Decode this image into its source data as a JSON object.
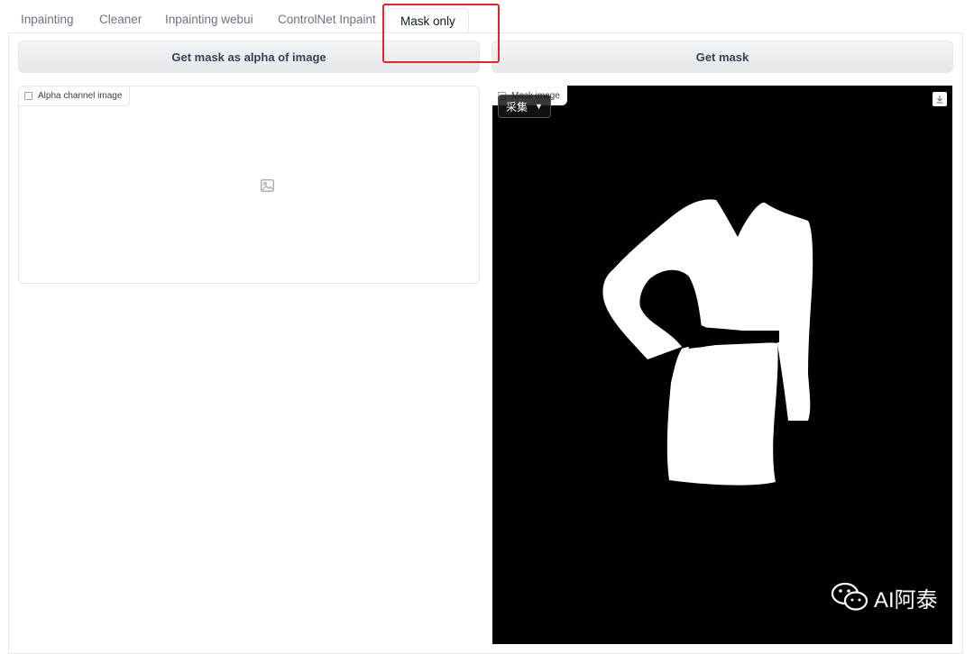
{
  "tabs": [
    {
      "label": "Inpainting"
    },
    {
      "label": "Cleaner"
    },
    {
      "label": "Inpainting webui"
    },
    {
      "label": "ControlNet Inpaint"
    },
    {
      "label": "Mask only",
      "active": true
    }
  ],
  "buttons": {
    "alpha": "Get mask as alpha of image",
    "mask": "Get mask"
  },
  "alpha_panel": {
    "label": "Alpha channel image",
    "icon": "image-placeholder-icon"
  },
  "mask_panel": {
    "label": "Mask image",
    "overlay_chip": "采集",
    "watermark": "AI阿泰",
    "icon": "download-icon"
  },
  "colors": {
    "highlight": "#e0262d",
    "mask_bg": "#000000",
    "mask_fg": "#ffffff"
  }
}
